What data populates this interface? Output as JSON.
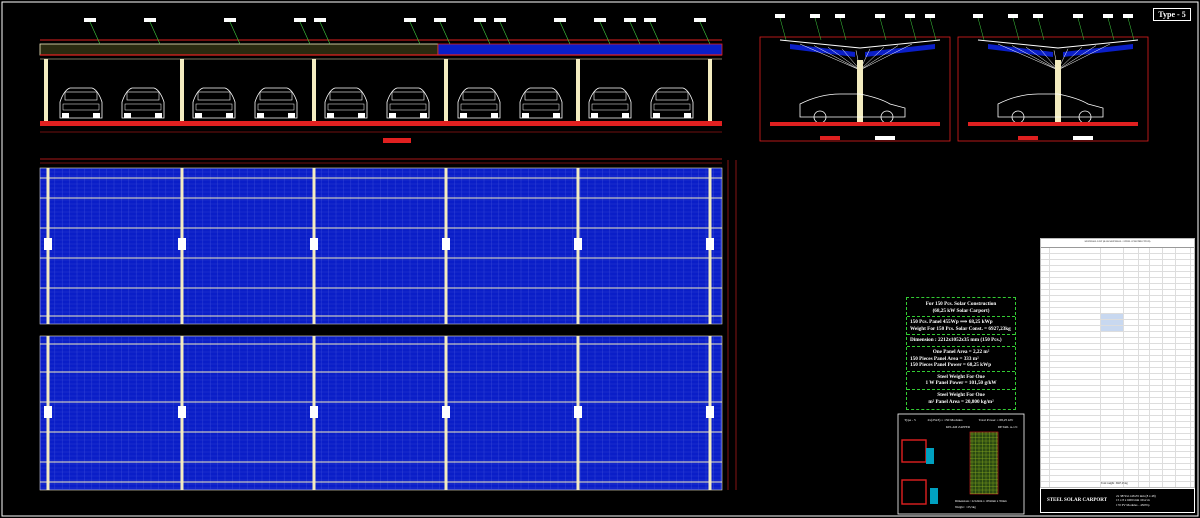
{
  "sheet": {
    "type_label": "Type - 5",
    "title": "STEEL SOLAR CARPORT",
    "meta": [
      "2x 3872x1143x35 mm (8 x 48)",
      "15 x 8 x 6000 mm 10x2 m",
      "170 PV Modules - 450Wp"
    ]
  },
  "notes": {
    "heading_1": "For 150 Pcs. Solar Construction",
    "heading_2": "(68,25 kW Solar Carport)",
    "line_power": "150 Pcs. Panel 455Wp  ⟹  68,25 kWp",
    "line_weight": "Weight For 150 Pcs. Solar Const. = 6927,23kg",
    "line_dims": "Dimension : 2212x1052x35 mm (150 Pcs.)",
    "area_one": "One Panel Area =      2,22 m²",
    "area_150": "150 Pieces Panel Area =  333 m²",
    "power_150": "150 Pieces Panel Power =   68,25 kWp",
    "steel_w_1": "Steel Weight For One",
    "steel_w_2": "1 W Panel Power = 101,50 g/kW",
    "steel_a_1": "Steel Weight For One",
    "steel_a_2": "m² Panel Area = 20,800 kg/m²"
  },
  "strips": {
    "a": "Type - 5",
    "b": "2x(25x3) = 150 Modules",
    "c": "Total Power = 68,25 kW"
  },
  "detail": {
    "label_1": "KELAM ZAPPER",
    "label_2": "DETAIL A-1/C",
    "caption_1": "Dimensions : 2212mm x 1052mm x 35mm",
    "caption_2": "Weight : ~25,5kg"
  },
  "bom": {
    "header": "MATERIAL LIST (RAW MATERIAL / STEEL CONSTRUCTION)",
    "footer": "Total weight : 6927,23 kg"
  },
  "colors": {
    "panel_blue": "#0a1ec8",
    "steel_red": "#e02020",
    "structure_cream": "#f3ecc0",
    "annotation_green": "#3fd03f",
    "label_white": "#ffffff"
  }
}
